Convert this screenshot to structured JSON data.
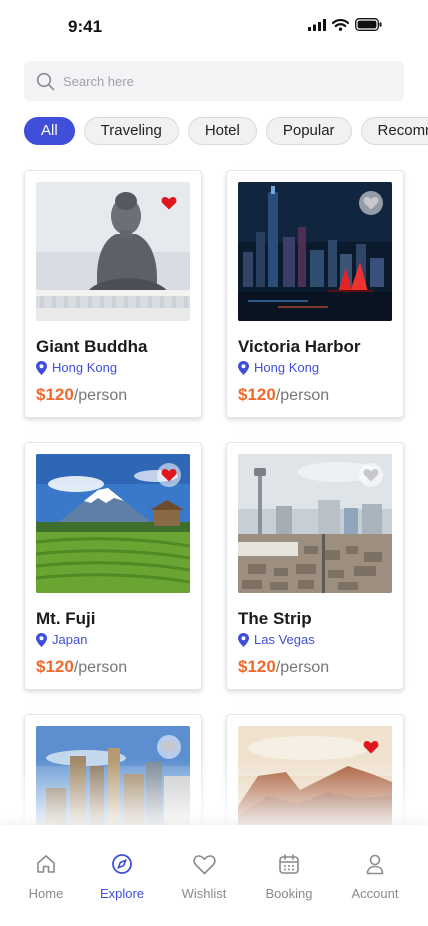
{
  "status_bar": {
    "time": "9:41"
  },
  "search": {
    "placeholder": "Search here"
  },
  "chips": [
    "All",
    "Traveling",
    "Hotel",
    "Popular",
    "Recommended"
  ],
  "active_chip": "All",
  "price_suffix": "/person",
  "cards": [
    {
      "title": "Giant Buddha",
      "location": "Hong Kong",
      "price": "$120",
      "favorited": true
    },
    {
      "title": "Victoria Harbor",
      "location": "Hong Kong",
      "price": "$120",
      "favorited": false
    },
    {
      "title": "Mt. Fuji",
      "location": "Japan",
      "price": "$120",
      "favorited": true
    },
    {
      "title": "The Strip",
      "location": "Las Vegas",
      "price": "$120",
      "favorited": false
    },
    {
      "title": "",
      "location": "",
      "price": "",
      "favorited": false
    },
    {
      "title": "",
      "location": "",
      "price": "",
      "favorited": true
    }
  ],
  "nav": [
    {
      "label": "Home",
      "icon": "home-icon",
      "active": false
    },
    {
      "label": "Explore",
      "icon": "compass-icon",
      "active": true
    },
    {
      "label": "Wishlist",
      "icon": "heart-icon",
      "active": false
    },
    {
      "label": "Booking",
      "icon": "calendar-icon",
      "active": false
    },
    {
      "label": "Account",
      "icon": "user-icon",
      "active": false
    }
  ],
  "colors": {
    "accent": "#3f4fd9",
    "price": "#ef6a2b",
    "favorite": "#e0161e",
    "chip_bg": "#f1f1f3",
    "search_bg": "#f3f3f5"
  }
}
